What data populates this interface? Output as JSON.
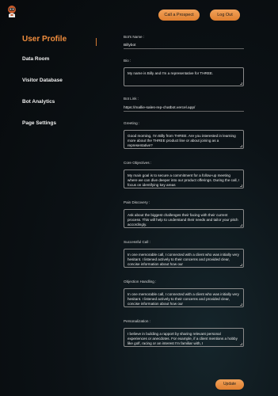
{
  "header": {
    "call_prospect": "Call a Prospect",
    "log_out": "Log Out"
  },
  "sidebar": {
    "items": [
      {
        "label": "User Profile",
        "active": true
      },
      {
        "label": "Data Room"
      },
      {
        "label": "Visitor Database"
      },
      {
        "label": "Bot Analytics"
      },
      {
        "label": "Page Settings"
      }
    ]
  },
  "form": {
    "bot_name": {
      "label": "Bot's Name :",
      "value": "Billybot"
    },
    "bio": {
      "label": "Bio :",
      "value": "My name is Billy and I'm a representative for THREE."
    },
    "bot_link": {
      "label": "Bot Link :",
      "value": "https://mallie-sales-rep-chatbot.vercel.app/"
    },
    "greeting": {
      "label": "Greeting :",
      "value": "Good morning, I'm Billy from THREE. Are you interested in learning more about the THREE product line or about joining as a representative?"
    },
    "core_objectives": {
      "label": "Core Objectives :",
      "value": "My main goal is to secure a commitment for a follow-up meeting where we can dive deeper into our product offerings. During the call, I focus on identifying key areas"
    },
    "pain_discovery": {
      "label": "Pain Discovery :",
      "value": "Ask about the biggest challenges their facing with their current process. This will help to understand their needs and tailor your pitch accordingly."
    },
    "successful_call": {
      "label": "Successful Call :",
      "value": "In one memorable call, I connected with a client who was initially very hesitant. I listened actively to their concerns and provided clear, concise information about how our"
    },
    "objection_handling": {
      "label": "Objection Handling :",
      "value": "In one memorable call, I connected with a client who was initially very hesitant. I listened actively to their concerns and provided clear, concise information about how our"
    },
    "personalization": {
      "label": "Personalization :",
      "value": "I believe in building a rapport by sharing relevant personal experiences or anecdotes. For example, if a client mentions a hobby like golf, racing or an interest I'm familiar with, I"
    }
  },
  "update_label": "Update",
  "colors": {
    "accent": "#f08d3d",
    "background": "#0c1216"
  }
}
